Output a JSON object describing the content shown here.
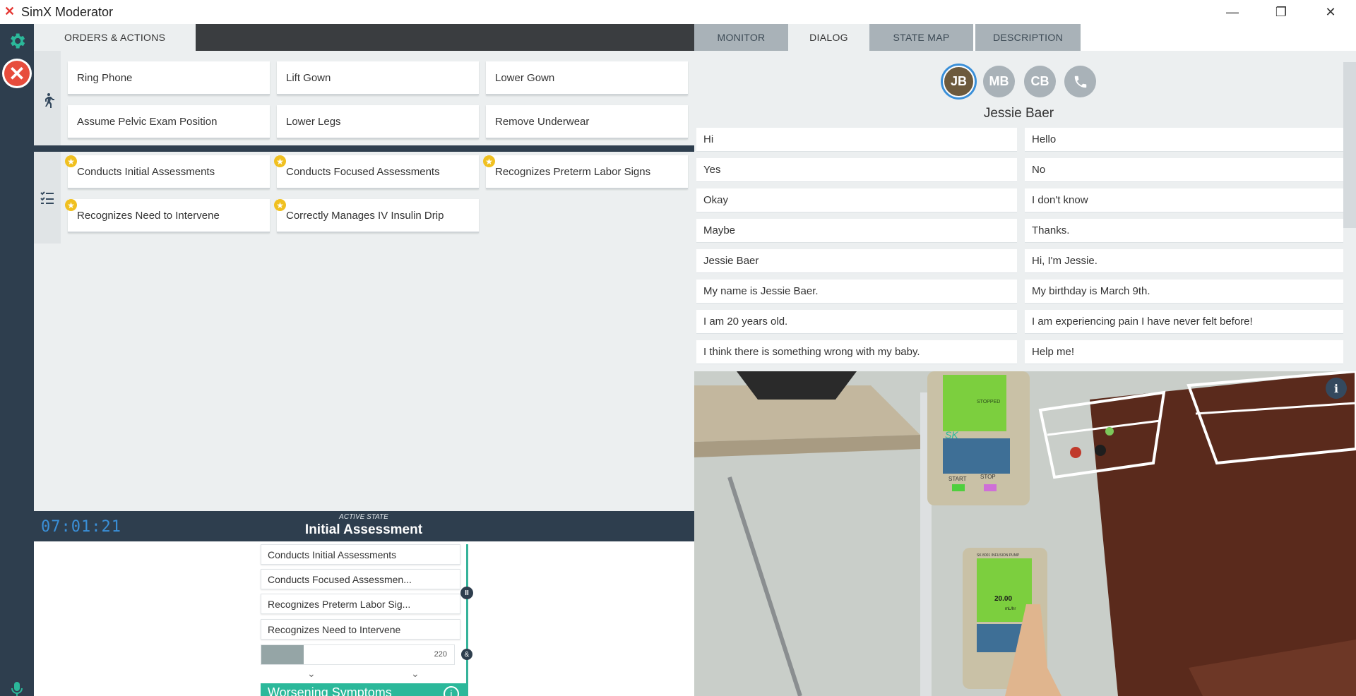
{
  "window": {
    "title": "SimX Moderator",
    "minimize_glyph": "—",
    "restore_glyph": "❐",
    "close_glyph": "✕"
  },
  "left_tab": {
    "label": "ORDERS & ACTIONS"
  },
  "right_tabs": [
    {
      "label": "MONITOR"
    },
    {
      "label": "DIALOG"
    },
    {
      "label": "STATE MAP"
    },
    {
      "label": "DESCRIPTION"
    }
  ],
  "actions": [
    {
      "label": "Ring Phone"
    },
    {
      "label": "Lift Gown"
    },
    {
      "label": "Lower Gown"
    },
    {
      "label": "Assume Pelvic Exam Position"
    },
    {
      "label": "Lower Legs"
    },
    {
      "label": "Remove Underwear"
    }
  ],
  "assessments": [
    {
      "label": "Conducts Initial Assessments",
      "starred": true
    },
    {
      "label": "Conducts Focused Assessments",
      "starred": true
    },
    {
      "label": "Recognizes Preterm Labor Signs",
      "starred": true
    },
    {
      "label": "Recognizes Need to Intervene",
      "starred": true
    },
    {
      "label": "Correctly Manages IV Insulin Drip",
      "starred": true
    }
  ],
  "timer": "07:01:21",
  "active_state": {
    "caption": "ACTIVE STATE",
    "name": "Initial Assessment",
    "items": [
      {
        "label": "Conducts Initial Assessments"
      },
      {
        "label": "Conducts Focused Assessmen..."
      },
      {
        "label": "Recognizes Preterm Labor Sig..."
      },
      {
        "label": "Recognizes Need to Intervene"
      }
    ],
    "progress_value": "220",
    "progress_fraction": 0.22,
    "next_state": "Worsening Symptoms"
  },
  "dialog": {
    "avatars": [
      {
        "initials": "JB",
        "active": true
      },
      {
        "initials": "MB",
        "active": false
      },
      {
        "initials": "CB",
        "active": false
      }
    ],
    "speaker": "Jessie Baer",
    "phrases": [
      "Hi",
      "Hello",
      "Yes",
      "No",
      "Okay",
      "I don't know",
      "Maybe",
      "Thanks.",
      "Jessie Baer",
      "Hi, I'm Jessie.",
      "My name is Jessie Baer.",
      "My birthday is March 9th.",
      "I am 20 years old.",
      "I am experiencing pain I have never felt before!",
      "I think there is something wrong with my baby.",
      "Help me!"
    ]
  },
  "view": {
    "pump_top_status": "STOPPED",
    "pump_top_brand": "SK",
    "pump_start": "START",
    "pump_stop": "STOP",
    "pump_bottom_title": "SK 8001 INFUSION PUMP",
    "pump_bottom_value": "20.00",
    "pump_bottom_unit": "mL/hr",
    "info_glyph": "i"
  }
}
